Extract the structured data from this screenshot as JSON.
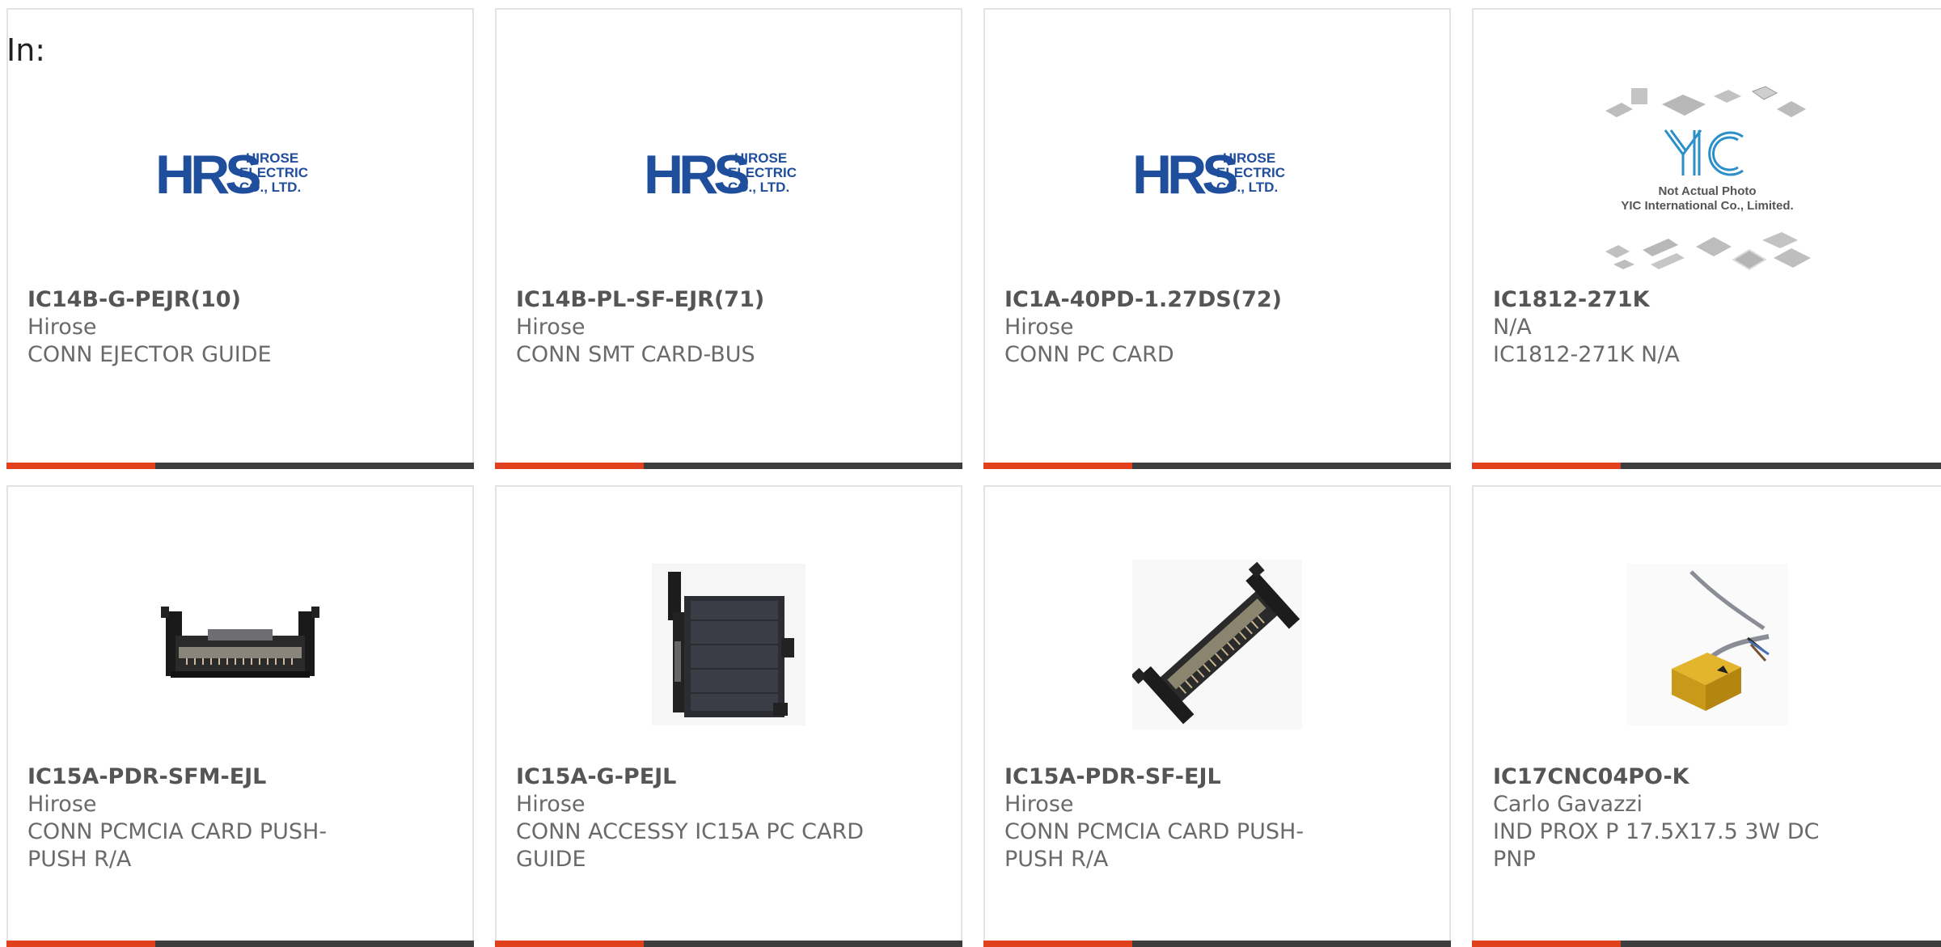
{
  "header": {
    "label": "In:"
  },
  "colors": {
    "accent_bar": "#e1401c",
    "dark_bar": "#3d3d3d",
    "hirose_blue": "#1f4e9c"
  },
  "cards": [
    {
      "part_number": "IC14B-G-PEJR(10)",
      "manufacturer": "Hirose",
      "description": "CONN EJECTOR GUIDE",
      "image": "hirose-logo",
      "logo_line1": "HIROSE",
      "logo_line2": "ELECTRIC",
      "logo_line3": "CO., LTD."
    },
    {
      "part_number": "IC14B-PL-SF-EJR(71)",
      "manufacturer": "Hirose",
      "description": "CONN SMT CARD-BUS",
      "image": "hirose-logo",
      "logo_line1": "HIROSE",
      "logo_line2": "ELECTRIC",
      "logo_line3": "CO., LTD."
    },
    {
      "part_number": "IC1A-40PD-1.27DS(72)",
      "manufacturer": "Hirose",
      "description": "CONN PC CARD",
      "image": "hirose-logo",
      "logo_line1": "HIROSE",
      "logo_line2": "ELECTRIC",
      "logo_line3": "CO., LTD."
    },
    {
      "part_number": "IC1812-271K",
      "manufacturer": "N/A",
      "description": "IC1812-271K N/A",
      "image": "yic-placeholder",
      "photo_note_line1": "Not Actual Photo",
      "photo_note_line2": "YIC International Co., Limited."
    },
    {
      "part_number": "IC15A-PDR-SFM-EJL",
      "manufacturer": "Hirose",
      "description": "CONN PCMCIA CARD PUSH-PUSH R/A",
      "image": "pcmcia-connector-photo"
    },
    {
      "part_number": "IC15A-G-PEJL",
      "manufacturer": "Hirose",
      "description": "CONN ACCESSY IC15A PC CARD GUIDE",
      "image": "card-guide-photo"
    },
    {
      "part_number": "IC15A-PDR-SF-EJL",
      "manufacturer": "Hirose",
      "description": "CONN PCMCIA CARD PUSH-PUSH R/A",
      "image": "pcmcia-angled-photo"
    },
    {
      "part_number": "IC17CNC04PO-K",
      "manufacturer": "Carlo Gavazzi",
      "description": "IND PROX P 17.5X17.5 3W DC PNP",
      "image": "proximity-sensor-photo"
    }
  ]
}
